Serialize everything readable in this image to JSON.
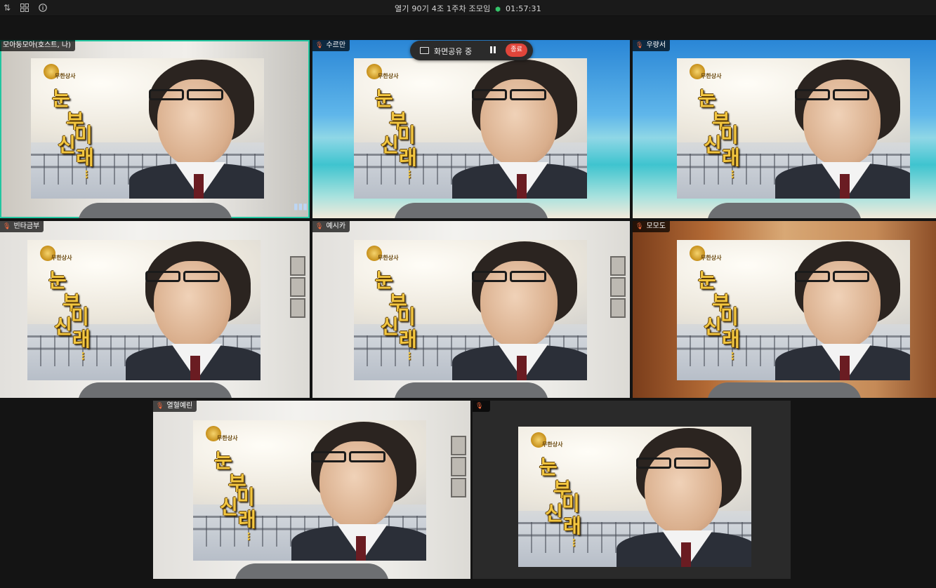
{
  "meeting": {
    "title": "열기 90기 4조 1주차 조모임",
    "time": "01:57:31"
  },
  "toolbar_icons": [
    "sort-icon",
    "grid-icon",
    "info-icon"
  ],
  "share_bar": {
    "label": "화면공유 중",
    "stop_label": "종료"
  },
  "caption": {
    "logo_text": "무한상사",
    "line1": "눈",
    "line2": "부",
    "line3": "신",
    "line4": "미",
    "line5": "래",
    "dots": "⋮"
  },
  "participants": [
    {
      "name": "모아둥모아(호스트, 나)",
      "background": "office",
      "active": true
    },
    {
      "name": "수르만",
      "background": "beach",
      "active": false
    },
    {
      "name": "우량서",
      "background": "beach",
      "active": false
    },
    {
      "name": "빈타금부",
      "background": "room",
      "active": false
    },
    {
      "name": "예시카",
      "background": "room",
      "active": false
    },
    {
      "name": "모모도",
      "background": "warm",
      "active": false
    },
    {
      "name": "열혈예린",
      "background": "room",
      "active": false
    },
    {
      "name": "",
      "background": "dark",
      "active": false
    }
  ],
  "colors": {
    "active_border": "#22c6a0",
    "stop_button": "#e0453a",
    "caption_gold": "#f2c640"
  }
}
